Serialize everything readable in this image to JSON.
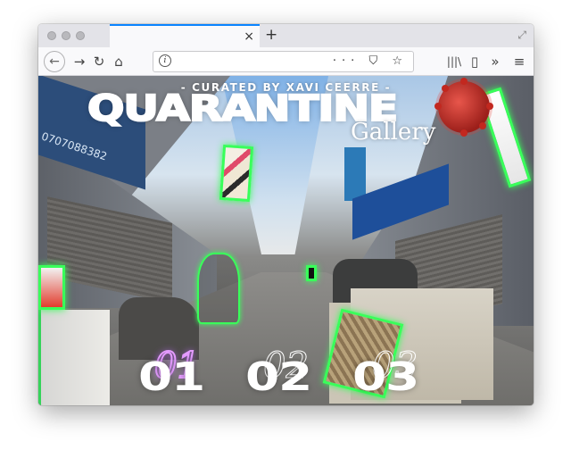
{
  "browser": {
    "new_tab_label": "+",
    "tab_close_label": "×",
    "nav": {
      "back_label": "←",
      "forward_label": "→",
      "reload_label": "↻",
      "home_label": "⌂"
    },
    "url": "",
    "url_actions_label": "··· ⛉ ☆",
    "toolbar": {
      "library_label": "|||\\",
      "sidebar_label": "▯",
      "overflow_label": "»",
      "menu_label": "≡"
    }
  },
  "page": {
    "curated_by": "- CURATED BY XAVI CEERRE -",
    "title": "QUARANTINE",
    "subtitle": "Gallery",
    "rooms": [
      {
        "number": "01"
      },
      {
        "number": "02"
      },
      {
        "number": "03"
      }
    ],
    "sign_text": "0707088382",
    "accent_color": "#39ff5a",
    "active_room_color": "#e49bff"
  }
}
